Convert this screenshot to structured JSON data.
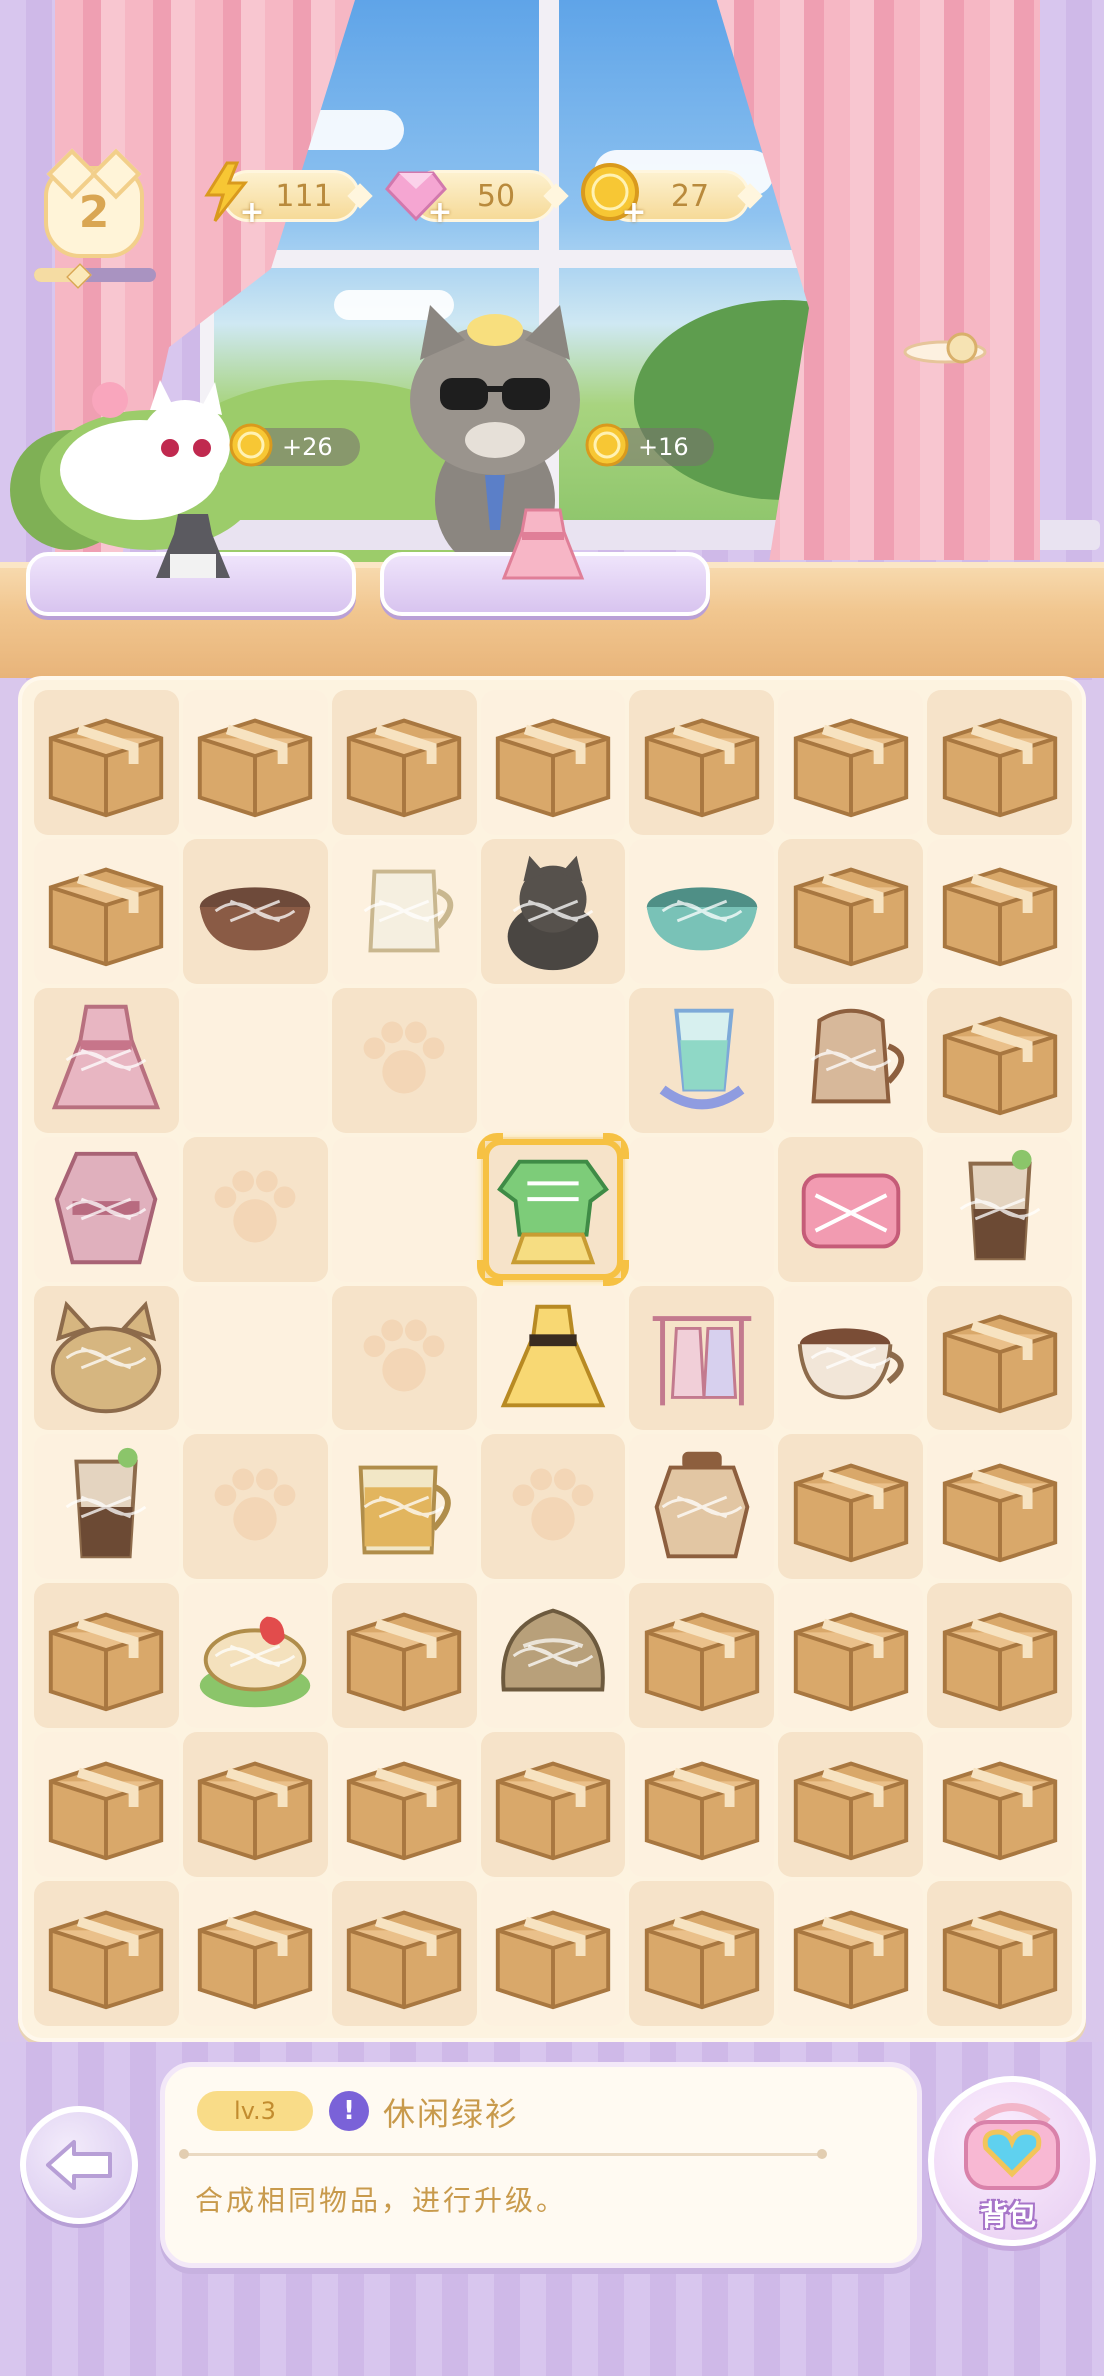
{
  "hud": {
    "player_level": "2",
    "xp_progress": 0.35,
    "energy": "111",
    "gems": "50",
    "coins": "27"
  },
  "customers": [
    {
      "name": "white-cat",
      "reward": "+26",
      "order_item": "black-dress"
    },
    {
      "name": "gray-cat-sunglasses",
      "reward": "+16",
      "order_item": "pink-dress"
    }
  ],
  "board": {
    "columns": 7,
    "rows": 9,
    "selected_item": "green-sweater-outfit",
    "cells": [
      [
        "box",
        "box",
        "box",
        "box",
        "box",
        "box",
        "box"
      ],
      [
        "box",
        "brown-bowl",
        "milk-jug",
        "black-cat",
        "teal-bowl",
        "box",
        "box"
      ],
      [
        "pink-dress",
        "empty",
        "paw",
        "empty",
        "water-glass",
        "coffee-jug",
        "box"
      ],
      [
        "pink-kimono",
        "paw",
        "empty",
        "green-sweater",
        "empty",
        "pink-bag",
        "iced-coffee"
      ],
      [
        "cat-bed",
        "empty",
        "paw",
        "yellow-dress",
        "clothes-rack",
        "coffee-cup",
        "box"
      ],
      [
        "iced-coffee",
        "paw",
        "tea-mug",
        "paw",
        "honey-jar",
        "box",
        "box"
      ],
      [
        "box",
        "strawberry-cake",
        "box",
        "bread-loaf",
        "box",
        "box",
        "box"
      ],
      [
        "box",
        "box",
        "box",
        "box",
        "box",
        "box",
        "box"
      ],
      [
        "box",
        "box",
        "box",
        "box",
        "box",
        "box",
        "box"
      ]
    ]
  },
  "info_panel": {
    "level_badge": "lv.3",
    "item_name": "休闲绿衫",
    "description": "合成相同物品，进行升级。"
  },
  "bag_button": {
    "label": "背包"
  },
  "colors": {
    "accent": "#f6c143",
    "text_gold": "#c89a4c",
    "panel_bg": "#fffaf2",
    "wall": "#d8c6ee"
  }
}
